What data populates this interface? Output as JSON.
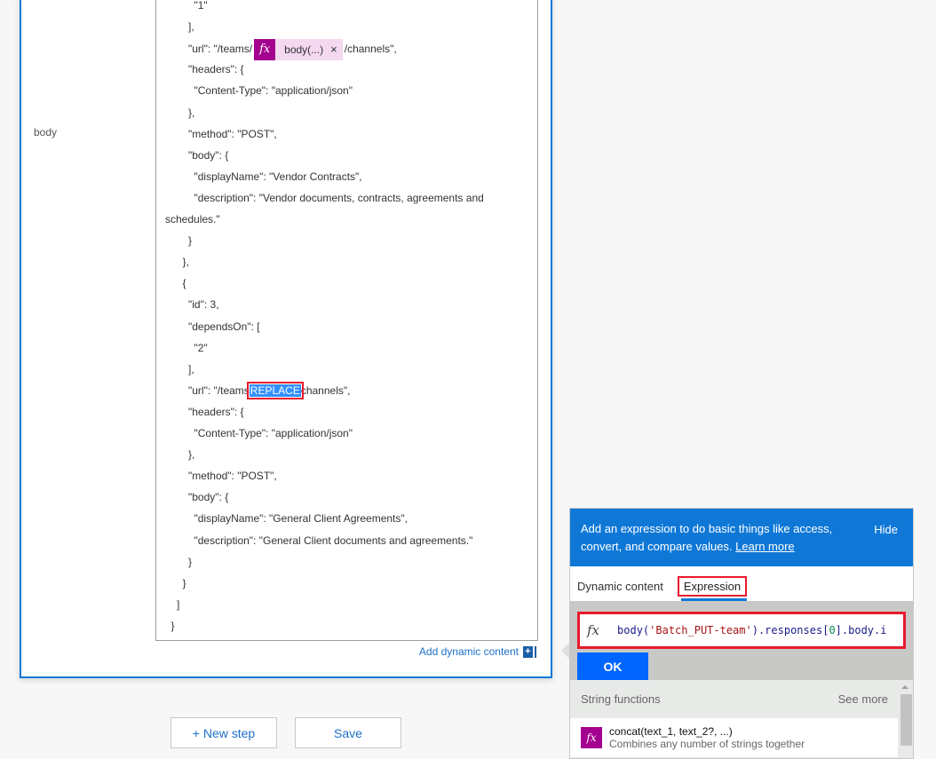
{
  "card": {
    "field_label": "body",
    "editor_lines": [
      {
        "indent": 5,
        "text": "\"1\""
      },
      {
        "indent": 4,
        "text": "],"
      },
      {
        "indent": 4,
        "pre": "\"url\": \"/teams/",
        "token": "body(...)",
        "post": "/channels\","
      },
      {
        "indent": 4,
        "text": "\"headers\": {"
      },
      {
        "indent": 5,
        "text": "\"Content-Type\": \"application/json\""
      },
      {
        "indent": 4,
        "text": "},"
      },
      {
        "indent": 4,
        "text": "\"method\": \"POST\","
      },
      {
        "indent": 4,
        "text": "\"body\": {"
      },
      {
        "indent": 5,
        "text": "\"displayName\": \"Vendor Contracts\","
      },
      {
        "indent": 5,
        "text": "\"description\": \"Vendor documents, contracts, agreements and"
      },
      {
        "indent": 0,
        "text": "schedules.\""
      },
      {
        "indent": 4,
        "text": "}"
      },
      {
        "indent": 3,
        "text": "},"
      },
      {
        "indent": 3,
        "text": "{"
      },
      {
        "indent": 4,
        "text": "\"id\": 3,"
      },
      {
        "indent": 4,
        "text": "\"dependsOn\": ["
      },
      {
        "indent": 5,
        "text": "\"2\""
      },
      {
        "indent": 4,
        "text": "],"
      },
      {
        "indent": 4,
        "pre": "\"url\": \"/teams/",
        "selected": "REPLACE",
        "post": "/channels\","
      },
      {
        "indent": 4,
        "text": "\"headers\": {"
      },
      {
        "indent": 5,
        "text": "\"Content-Type\": \"application/json\""
      },
      {
        "indent": 4,
        "text": "},"
      },
      {
        "indent": 4,
        "text": "\"method\": \"POST\","
      },
      {
        "indent": 4,
        "text": "\"body\": {"
      },
      {
        "indent": 5,
        "text": "\"displayName\": \"General Client Agreements\","
      },
      {
        "indent": 5,
        "text": "\"description\": \"General Client documents and agreements.\""
      },
      {
        "indent": 4,
        "text": "}"
      },
      {
        "indent": 3,
        "text": "}"
      },
      {
        "indent": 2,
        "text": "]"
      },
      {
        "indent": 1,
        "text": "}"
      }
    ],
    "token": {
      "icon": "fx-icon",
      "label": "body(...)",
      "remove": "×"
    },
    "add_dynamic_content": "Add dynamic content",
    "add_dynamic_icon": "+"
  },
  "footer": {
    "new_step": "+ New step",
    "save": "Save"
  },
  "panel": {
    "description": "Add an expression to do basic things like access, convert, and compare values.",
    "learn_more": "Learn more",
    "hide": "Hide",
    "tabs": [
      {
        "label": "Dynamic content",
        "active": false
      },
      {
        "label": "Expression",
        "active": true
      }
    ],
    "expression": {
      "fx": "fx",
      "parts": [
        {
          "t": "fn",
          "v": "body("
        },
        {
          "t": "str",
          "v": "'Batch_PUT-team'"
        },
        {
          "t": "fn",
          "v": ").responses["
        },
        {
          "t": "num",
          "v": "0"
        },
        {
          "t": "fn",
          "v": "].body.i"
        }
      ]
    },
    "ok": "OK",
    "section": "String functions",
    "see_more": "See more",
    "functions": [
      {
        "name": "concat(text_1, text_2?, ...)",
        "description": "Combines any number of strings together"
      }
    ],
    "colors": {
      "accent": "#0f78d7",
      "ok": "#0066ff",
      "highlight": "#e8192c",
      "fx": "#a4008f"
    }
  }
}
